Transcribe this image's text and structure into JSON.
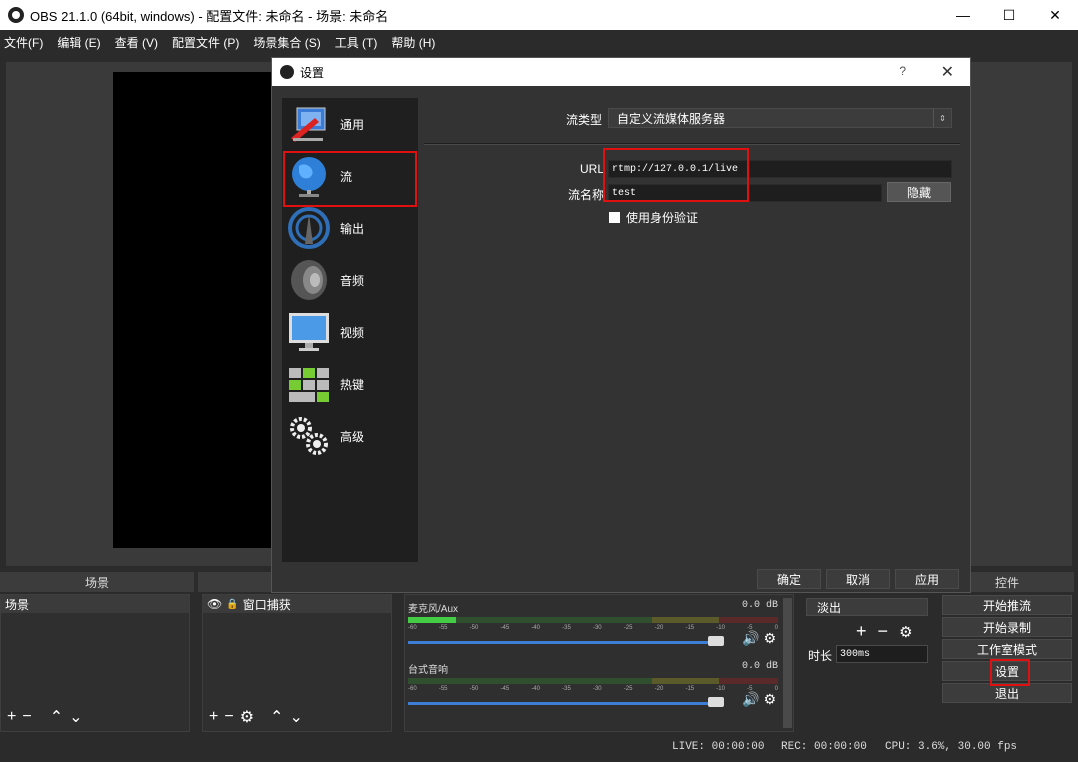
{
  "window": {
    "title": "OBS 21.1.0 (64bit, windows) - 配置文件: 未命名 - 场景: 未命名",
    "minimize": "—",
    "maximize": "☐",
    "close": "✕"
  },
  "menu": [
    "文件(F)",
    "编辑 (E)",
    "查看 (V)",
    "配置文件 (P)",
    "场景集合 (S)",
    "工具 (T)",
    "帮助 (H)"
  ],
  "docks": {
    "scenes_header": "场景",
    "sources_header": "",
    "controls_header": "控件",
    "scene_item": "场景",
    "source_item": "窗口捕获"
  },
  "mixer": {
    "tracks": [
      {
        "name": "麦克风/Aux",
        "db": "0.0 dB"
      },
      {
        "name": "台式音响",
        "db": "0.0 dB"
      }
    ],
    "ticks": [
      "-60",
      "-55",
      "-50",
      "-45",
      "-40",
      "-35",
      "-30",
      "-25",
      "-20",
      "-15",
      "-10",
      "-5",
      "0"
    ]
  },
  "transition": {
    "type": "淡出",
    "duration_label": "时长",
    "duration_value": "300ms"
  },
  "controls": {
    "start_stream": "开始推流",
    "start_record": "开始录制",
    "studio_mode": "工作室模式",
    "settings": "设置",
    "exit": "退出"
  },
  "status": {
    "live": "LIVE: 00:00:00",
    "rec": "REC: 00:00:00",
    "cpu": "CPU: 3.6%, 30.00 fps"
  },
  "dialog": {
    "title": "设置",
    "help": "?",
    "close": "✕",
    "sidebar": [
      {
        "label": "通用",
        "icon": "general-icon"
      },
      {
        "label": "流",
        "icon": "globe-icon"
      },
      {
        "label": "输出",
        "icon": "output-icon"
      },
      {
        "label": "音频",
        "icon": "speaker-icon"
      },
      {
        "label": "视频",
        "icon": "monitor-icon"
      },
      {
        "label": "热键",
        "icon": "keyboard-icon"
      },
      {
        "label": "高级",
        "icon": "gears-icon"
      }
    ],
    "stream_type_label": "流类型",
    "stream_type_value": "自定义流媒体服务器",
    "url_label": "URL",
    "url_value": "rtmp://127.0.0.1/live",
    "key_label": "流名称",
    "key_value": "test",
    "hide_button": "隐藏",
    "auth_checkbox": "使用身份验证",
    "ok": "确定",
    "cancel": "取消",
    "apply": "应用"
  },
  "colors": {
    "highlight_red": "#e01010",
    "slider_blue": "#3d7fd6"
  }
}
